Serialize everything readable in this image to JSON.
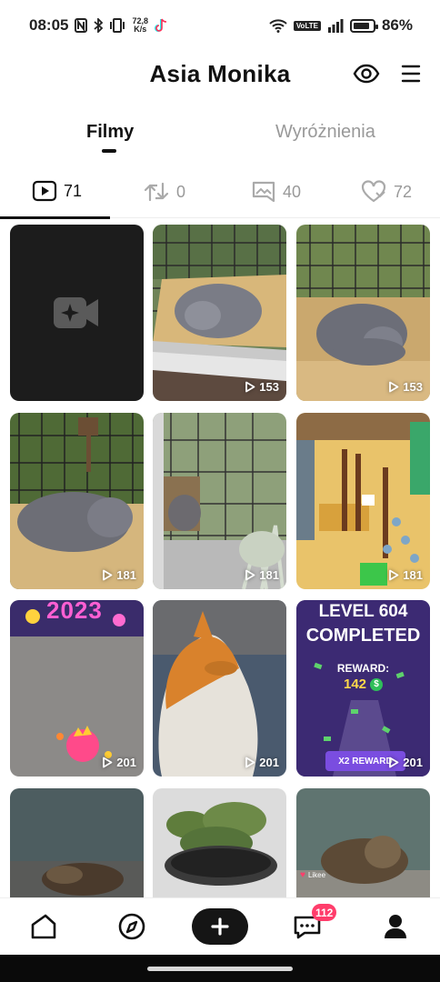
{
  "status_bar": {
    "time": "08:05",
    "speed_value": "72,8",
    "speed_unit": "K/s",
    "network": "VoLTE",
    "battery": "86%"
  },
  "header": {
    "title": "Asia Monika"
  },
  "tabs": [
    {
      "label": "Filmy",
      "active": true
    },
    {
      "label": "Wyróżnienia",
      "active": false
    }
  ],
  "stats": [
    {
      "icon": "video-play-icon",
      "count": "71",
      "active": true
    },
    {
      "icon": "repost-icon",
      "count": "0",
      "active": false
    },
    {
      "icon": "bookmark-image-icon",
      "count": "40",
      "active": false
    },
    {
      "icon": "heart-icon",
      "count": "72",
      "active": false
    }
  ],
  "videos": [
    {
      "type": "placeholder",
      "views": ""
    },
    {
      "type": "cat",
      "views": "153"
    },
    {
      "type": "cat",
      "views": "153"
    },
    {
      "type": "cat",
      "views": "181"
    },
    {
      "type": "garden",
      "views": "181"
    },
    {
      "type": "game",
      "views": "181"
    },
    {
      "type": "game",
      "views": "201"
    },
    {
      "type": "cat",
      "views": "201"
    },
    {
      "type": "game",
      "views": "201"
    },
    {
      "type": "cat",
      "views": ""
    },
    {
      "type": "plant",
      "views": ""
    },
    {
      "type": "cat",
      "views": ""
    }
  ],
  "overlays": {
    "game_title": "2023",
    "level_line1": "LEVEL 604",
    "level_line2": "COMPLETED",
    "reward_label": "REWARD:",
    "reward_value": "142",
    "reward_button": "X2 REWARD",
    "watermark": "Likee"
  },
  "bottom_nav": {
    "messages_badge": "112"
  }
}
